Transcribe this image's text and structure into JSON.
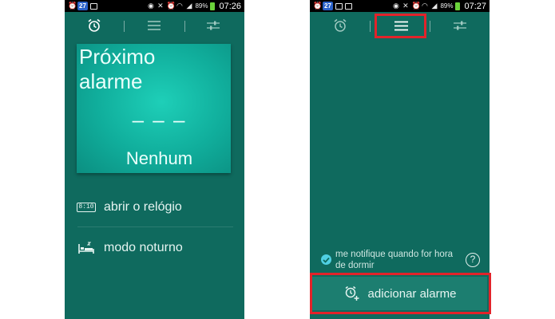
{
  "left_screen": {
    "statusbar": {
      "left_icons": [
        "alarm-clock-icon",
        "calendar-icon",
        "checkbox-icon"
      ],
      "calendar_badge": "27",
      "right_icons": [
        "eye-icon",
        "mute-icon",
        "alarm-icon",
        "wifi-icon",
        "signal-icon"
      ],
      "battery": "89%",
      "time": "07:26"
    },
    "tabs": [
      {
        "icon": "alarm-clock-icon",
        "active": true
      },
      {
        "icon": "list-icon",
        "active": false
      },
      {
        "icon": "sliders-icon",
        "active": false
      }
    ],
    "next_alarm": {
      "title": "Próximo alarme",
      "time": "– – –",
      "value": "Nenhum"
    },
    "menu": [
      {
        "icon": "digital-clock-icon",
        "icon_text": "8:10",
        "label": "abrir o relógio"
      },
      {
        "icon": "bed-icon",
        "label": "modo noturno"
      }
    ]
  },
  "right_screen": {
    "statusbar": {
      "left_icons": [
        "alarm-clock-icon",
        "calendar-icon",
        "image-icon",
        "checkbox-icon"
      ],
      "calendar_badge": "27",
      "right_icons": [
        "eye-icon",
        "mute-icon",
        "alarm-icon",
        "wifi-icon",
        "signal-icon"
      ],
      "battery": "89%",
      "time": "07:27"
    },
    "tabs": [
      {
        "icon": "alarm-clock-icon",
        "active": false
      },
      {
        "icon": "list-icon",
        "active": true
      },
      {
        "icon": "sliders-icon",
        "active": false
      }
    ],
    "notify": {
      "checked": true,
      "label": "me notifique quando for hora de dormir",
      "help": "?"
    },
    "add_alarm_button": {
      "icon": "add-alarm-icon",
      "label": "adicionar alarme"
    }
  },
  "colors": {
    "background": "#0f6a5e",
    "card_accent": "#10ad9b",
    "highlight": "#e2232a",
    "checkbox": "#4fd0e3"
  }
}
